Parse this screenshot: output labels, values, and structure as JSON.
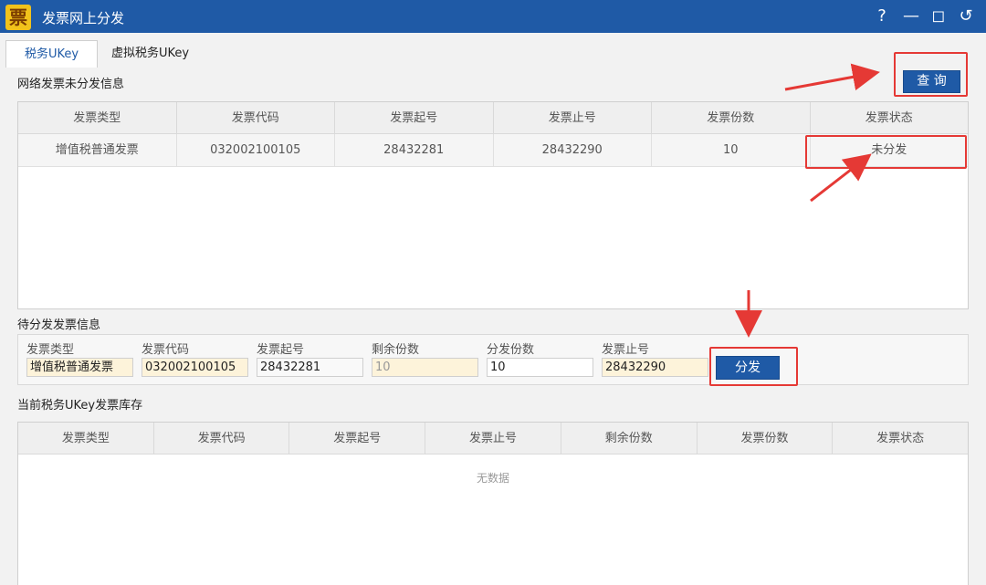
{
  "window": {
    "logo_char": "票",
    "title": "发票网上分发",
    "controls": {
      "help": "?",
      "minimize": "—",
      "maximize": "◻",
      "back": "↺"
    }
  },
  "tabs": [
    {
      "label": "税务UKey",
      "active": true
    },
    {
      "label": "虚拟税务UKey",
      "active": false
    }
  ],
  "network_section": {
    "label": "网络发票未分发信息",
    "query_button": "查 询",
    "columns": [
      "发票类型",
      "发票代码",
      "发票起号",
      "发票止号",
      "发票份数",
      "发票状态"
    ],
    "rows": [
      [
        "增值税普通发票",
        "032002100105",
        "28432281",
        "28432290",
        "10",
        "未分发"
      ]
    ]
  },
  "pending_section": {
    "label": "待分发发票信息",
    "fields": [
      {
        "label": "发票类型",
        "value": "增值税普通发票"
      },
      {
        "label": "发票代码",
        "value": "032002100105"
      },
      {
        "label": "发票起号",
        "value": "28432281"
      },
      {
        "label": "剩余份数",
        "value": "10"
      },
      {
        "label": "分发份数",
        "value": "10"
      },
      {
        "label": "发票止号",
        "value": "28432290"
      }
    ],
    "distribute_button": "分发"
  },
  "inventory_section": {
    "label": "当前税务UKey发票库存",
    "columns": [
      "发票类型",
      "发票代码",
      "发票起号",
      "发票止号",
      "剩余份数",
      "发票份数",
      "发票状态"
    ],
    "empty_text": "无数据"
  },
  "colors": {
    "titlebar": "#1f5aa6",
    "button": "#1f5aa6",
    "highlight": "#e53935",
    "readonly_field": "#fdf3da"
  }
}
